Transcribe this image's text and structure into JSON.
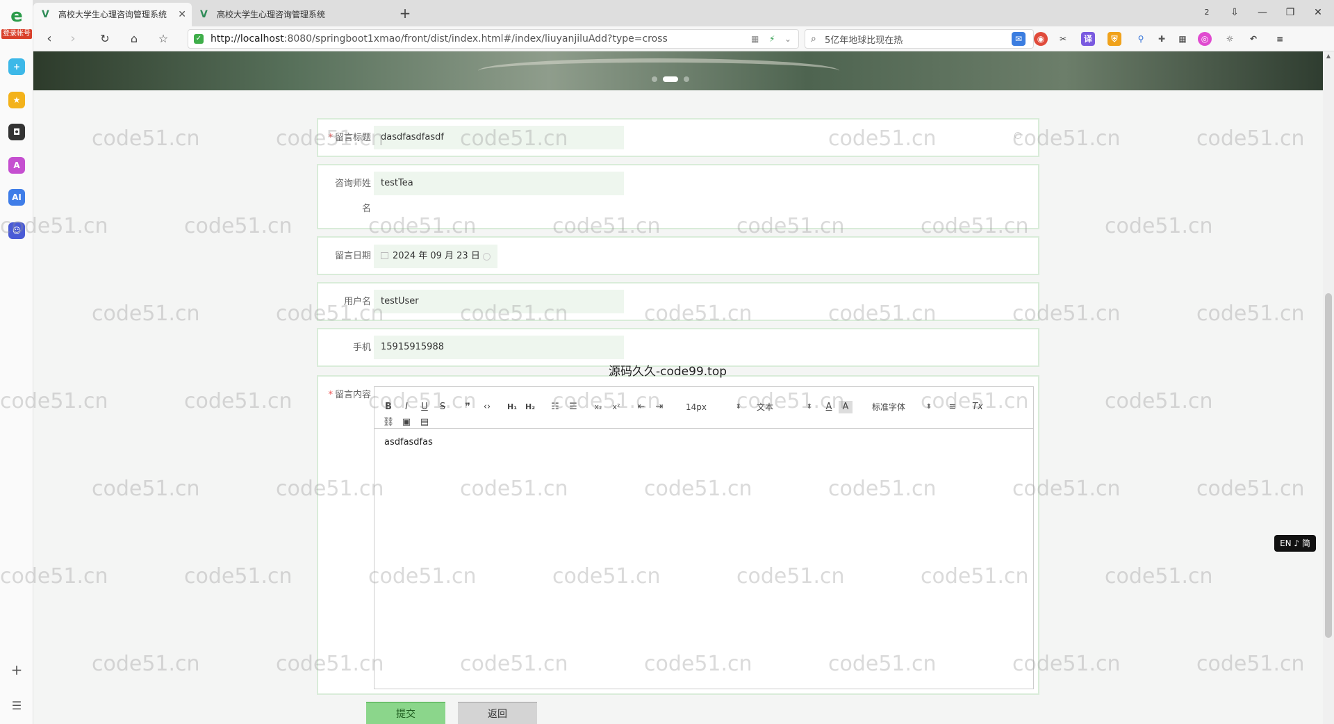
{
  "browser": {
    "login_badge": "登录帐号",
    "tabs": [
      {
        "title": "高校大学生心理咨询管理系统",
        "active": true
      },
      {
        "title": "高校大学生心理咨询管理系统",
        "active": false
      }
    ],
    "url_host": "http://localhost",
    "url_rest": ":8080/springboot1xmao/front/dist/index.html#/index/liuyanjiluAdd?type=cross",
    "search_text": "5亿年地球比现在热",
    "tab_count_badge": "2"
  },
  "form": {
    "title_label": "留言标题",
    "title_value": "dasdfasdfasdf",
    "counselor_label_line1": "咨询师姓",
    "counselor_label_line2": "名",
    "counselor_value": "testTea",
    "date_label": "留言日期",
    "date_value": "2024 年 09 月 23 日",
    "username_label": "用户名",
    "username_value": "testUser",
    "phone_label": "手机",
    "phone_value": "15915915988",
    "content_label": "留言内容",
    "required_mark": "*",
    "editor": {
      "font_size": "14px",
      "block_type": "文本",
      "font_family": "标准字体",
      "body_text": "asdfasdfas"
    }
  },
  "buttons": {
    "submit": "提交",
    "back": "返回"
  },
  "overlay": {
    "source_text": "源码久久-code99.top",
    "ime": "EN ♪ 简"
  },
  "watermark": "code51.cn"
}
